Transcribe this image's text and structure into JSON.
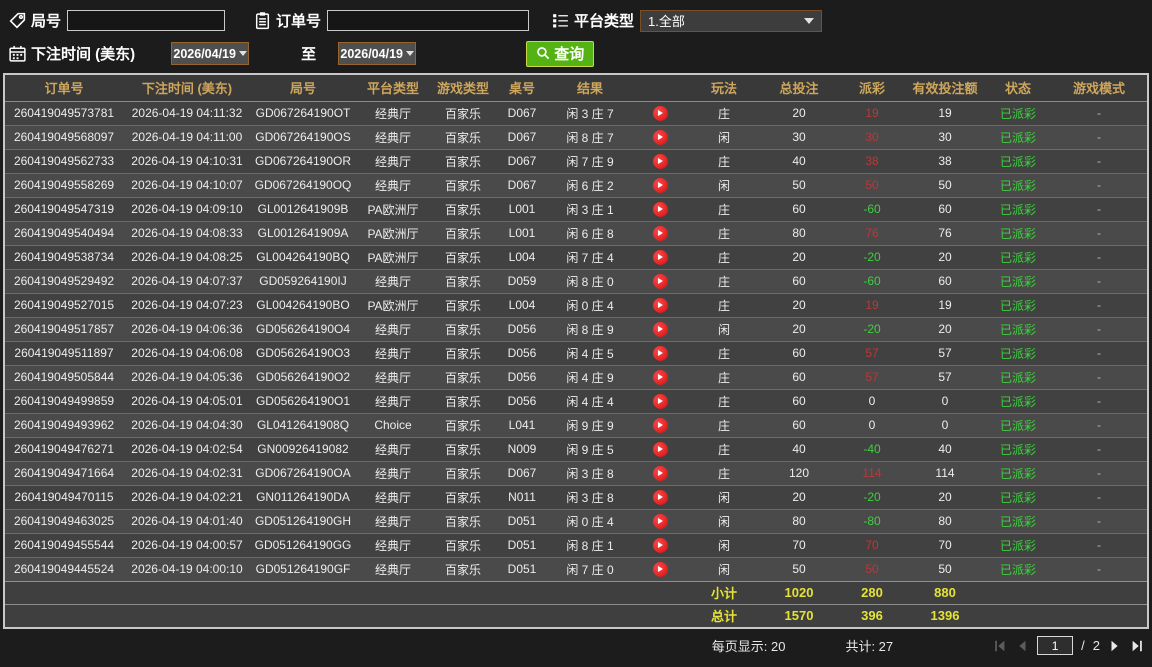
{
  "filters": {
    "round_label": "局号",
    "round_value": "",
    "order_label": "订单号",
    "order_value": "",
    "platform_label": "平台类型",
    "platform_value": "1.全部",
    "bet_time_label": "下注时间 (美东)",
    "date_from": "2026/04/19",
    "to_label": "至",
    "date_to": "2026/04/19",
    "search_label": "查询"
  },
  "table": {
    "columns": [
      "订单号",
      "下注时间 (美东)",
      "局号",
      "平台类型",
      "游戏类型",
      "桌号",
      "结果",
      "",
      "玩法",
      "总投注",
      "派彩",
      "有效投注额",
      "状态",
      "游戏模式"
    ],
    "rows": [
      {
        "order_no": "260419049573781",
        "bet_time": "2026-04-19 04:11:32",
        "round_no": "GD067264190OT",
        "platform": "经典厅",
        "game_type": "百家乐",
        "table_no": "D067",
        "result": "闲 3 庄 7",
        "play_side": "庄",
        "total_bet": "20",
        "payout": "19",
        "valid_bet": "19",
        "status": "已派彩",
        "game_mode": "-"
      },
      {
        "order_no": "260419049568097",
        "bet_time": "2026-04-19 04:11:00",
        "round_no": "GD067264190OS",
        "platform": "经典厅",
        "game_type": "百家乐",
        "table_no": "D067",
        "result": "闲 8 庄 7",
        "play_side": "闲",
        "total_bet": "30",
        "payout": "30",
        "valid_bet": "30",
        "status": "已派彩",
        "game_mode": "-"
      },
      {
        "order_no": "260419049562733",
        "bet_time": "2026-04-19 04:10:31",
        "round_no": "GD067264190OR",
        "platform": "经典厅",
        "game_type": "百家乐",
        "table_no": "D067",
        "result": "闲 7 庄 9",
        "play_side": "庄",
        "total_bet": "40",
        "payout": "38",
        "valid_bet": "38",
        "status": "已派彩",
        "game_mode": "-"
      },
      {
        "order_no": "260419049558269",
        "bet_time": "2026-04-19 04:10:07",
        "round_no": "GD067264190OQ",
        "platform": "经典厅",
        "game_type": "百家乐",
        "table_no": "D067",
        "result": "闲 6 庄 2",
        "play_side": "闲",
        "total_bet": "50",
        "payout": "50",
        "valid_bet": "50",
        "status": "已派彩",
        "game_mode": "-"
      },
      {
        "order_no": "260419049547319",
        "bet_time": "2026-04-19 04:09:10",
        "round_no": "GL0012641909B",
        "platform": "PA欧洲厅",
        "game_type": "百家乐",
        "table_no": "L001",
        "result": "闲 3 庄 1",
        "play_side": "庄",
        "total_bet": "60",
        "payout": "-60",
        "valid_bet": "60",
        "status": "已派彩",
        "game_mode": "-"
      },
      {
        "order_no": "260419049540494",
        "bet_time": "2026-04-19 04:08:33",
        "round_no": "GL0012641909A",
        "platform": "PA欧洲厅",
        "game_type": "百家乐",
        "table_no": "L001",
        "result": "闲 6 庄 8",
        "play_side": "庄",
        "total_bet": "80",
        "payout": "76",
        "valid_bet": "76",
        "status": "已派彩",
        "game_mode": "-"
      },
      {
        "order_no": "260419049538734",
        "bet_time": "2026-04-19 04:08:25",
        "round_no": "GL004264190BQ",
        "platform": "PA欧洲厅",
        "game_type": "百家乐",
        "table_no": "L004",
        "result": "闲 7 庄 4",
        "play_side": "庄",
        "total_bet": "20",
        "payout": "-20",
        "valid_bet": "20",
        "status": "已派彩",
        "game_mode": "-"
      },
      {
        "order_no": "260419049529492",
        "bet_time": "2026-04-19 04:07:37",
        "round_no": "GD059264190IJ",
        "platform": "经典厅",
        "game_type": "百家乐",
        "table_no": "D059",
        "result": "闲 8 庄 0",
        "play_side": "庄",
        "total_bet": "60",
        "payout": "-60",
        "valid_bet": "60",
        "status": "已派彩",
        "game_mode": "-"
      },
      {
        "order_no": "260419049527015",
        "bet_time": "2026-04-19 04:07:23",
        "round_no": "GL004264190BO",
        "platform": "PA欧洲厅",
        "game_type": "百家乐",
        "table_no": "L004",
        "result": "闲 0 庄 4",
        "play_side": "庄",
        "total_bet": "20",
        "payout": "19",
        "valid_bet": "19",
        "status": "已派彩",
        "game_mode": "-"
      },
      {
        "order_no": "260419049517857",
        "bet_time": "2026-04-19 04:06:36",
        "round_no": "GD056264190O4",
        "platform": "经典厅",
        "game_type": "百家乐",
        "table_no": "D056",
        "result": "闲 8 庄 9",
        "play_side": "闲",
        "total_bet": "20",
        "payout": "-20",
        "valid_bet": "20",
        "status": "已派彩",
        "game_mode": "-"
      },
      {
        "order_no": "260419049511897",
        "bet_time": "2026-04-19 04:06:08",
        "round_no": "GD056264190O3",
        "platform": "经典厅",
        "game_type": "百家乐",
        "table_no": "D056",
        "result": "闲 4 庄 5",
        "play_side": "庄",
        "total_bet": "60",
        "payout": "57",
        "valid_bet": "57",
        "status": "已派彩",
        "game_mode": "-"
      },
      {
        "order_no": "260419049505844",
        "bet_time": "2026-04-19 04:05:36",
        "round_no": "GD056264190O2",
        "platform": "经典厅",
        "game_type": "百家乐",
        "table_no": "D056",
        "result": "闲 4 庄 9",
        "play_side": "庄",
        "total_bet": "60",
        "payout": "57",
        "valid_bet": "57",
        "status": "已派彩",
        "game_mode": "-"
      },
      {
        "order_no": "260419049499859",
        "bet_time": "2026-04-19 04:05:01",
        "round_no": "GD056264190O1",
        "platform": "经典厅",
        "game_type": "百家乐",
        "table_no": "D056",
        "result": "闲 4 庄 4",
        "play_side": "庄",
        "total_bet": "60",
        "payout": "0",
        "valid_bet": "0",
        "status": "已派彩",
        "game_mode": "-"
      },
      {
        "order_no": "260419049493962",
        "bet_time": "2026-04-19 04:04:30",
        "round_no": "GL0412641908Q",
        "platform": "Choice",
        "game_type": "百家乐",
        "table_no": "L041",
        "result": "闲 9 庄 9",
        "play_side": "庄",
        "total_bet": "60",
        "payout": "0",
        "valid_bet": "0",
        "status": "已派彩",
        "game_mode": "-"
      },
      {
        "order_no": "260419049476271",
        "bet_time": "2026-04-19 04:02:54",
        "round_no": "GN00926419082",
        "platform": "经典厅",
        "game_type": "百家乐",
        "table_no": "N009",
        "result": "闲 9 庄 5",
        "play_side": "庄",
        "total_bet": "40",
        "payout": "-40",
        "valid_bet": "40",
        "status": "已派彩",
        "game_mode": "-"
      },
      {
        "order_no": "260419049471664",
        "bet_time": "2026-04-19 04:02:31",
        "round_no": "GD067264190OA",
        "platform": "经典厅",
        "game_type": "百家乐",
        "table_no": "D067",
        "result": "闲 3 庄 8",
        "play_side": "庄",
        "total_bet": "120",
        "payout": "114",
        "valid_bet": "114",
        "status": "已派彩",
        "game_mode": "-"
      },
      {
        "order_no": "260419049470115",
        "bet_time": "2026-04-19 04:02:21",
        "round_no": "GN011264190DA",
        "platform": "经典厅",
        "game_type": "百家乐",
        "table_no": "N011",
        "result": "闲 3 庄 8",
        "play_side": "闲",
        "total_bet": "20",
        "payout": "-20",
        "valid_bet": "20",
        "status": "已派彩",
        "game_mode": "-"
      },
      {
        "order_no": "260419049463025",
        "bet_time": "2026-04-19 04:01:40",
        "round_no": "GD051264190GH",
        "platform": "经典厅",
        "game_type": "百家乐",
        "table_no": "D051",
        "result": "闲 0 庄 4",
        "play_side": "闲",
        "total_bet": "80",
        "payout": "-80",
        "valid_bet": "80",
        "status": "已派彩",
        "game_mode": "-"
      },
      {
        "order_no": "260419049455544",
        "bet_time": "2026-04-19 04:00:57",
        "round_no": "GD051264190GG",
        "platform": "经典厅",
        "game_type": "百家乐",
        "table_no": "D051",
        "result": "闲 8 庄 1",
        "play_side": "闲",
        "total_bet": "70",
        "payout": "70",
        "valid_bet": "70",
        "status": "已派彩",
        "game_mode": "-"
      },
      {
        "order_no": "260419049445524",
        "bet_time": "2026-04-19 04:00:10",
        "round_no": "GD051264190GF",
        "platform": "经典厅",
        "game_type": "百家乐",
        "table_no": "D051",
        "result": "闲 7 庄 0",
        "play_side": "闲",
        "total_bet": "50",
        "payout": "50",
        "valid_bet": "50",
        "status": "已派彩",
        "game_mode": "-"
      }
    ],
    "subtotal": {
      "label": "小计",
      "total_bet": "1020",
      "payout": "280",
      "valid_bet": "880"
    },
    "grand_total": {
      "label": "总计",
      "total_bet": "1570",
      "payout": "396",
      "valid_bet": "1396"
    }
  },
  "footer": {
    "page_size_text": "每页显示: 20",
    "total_count_text": "共计: 27",
    "current_page": "1",
    "page_separator": "/",
    "total_pages": "2"
  },
  "colors": {
    "header_text": "#cda65c",
    "payout_positive": "#bd3737",
    "payout_negative": "#3fd03f",
    "status_paid": "#3cd43c",
    "totals_yellow": "#e5e335",
    "query_button": "#55b213",
    "play_icon": "#e01515"
  }
}
